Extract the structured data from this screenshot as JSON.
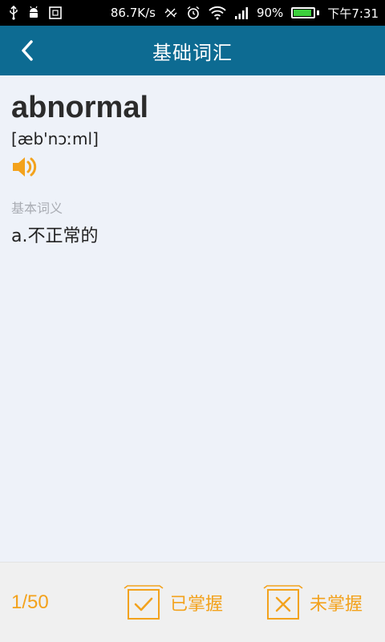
{
  "status_bar": {
    "network_speed": "86.7K/s",
    "battery_percent": "90%",
    "time": "下午7:31",
    "battery_level": 0.9,
    "icons": [
      "usb-icon",
      "android-icon",
      "screenshot-icon",
      "data-sync-icon",
      "alarm-icon",
      "wifi-icon",
      "signal-icon",
      "battery-icon"
    ]
  },
  "header": {
    "title": "基础词汇",
    "back_icon": "chevron-left-icon"
  },
  "word_card": {
    "word": "abnormal",
    "phonetic": "[æb'nɔːml]",
    "speaker_icon": "speaker-icon",
    "section_label": "基本词义",
    "definition": "a.不正常的"
  },
  "bottom_bar": {
    "progress": "1/50",
    "mastered_label": "已掌握",
    "not_mastered_label": "未掌握"
  },
  "colors": {
    "header_bg": "#0d6b92",
    "accent": "#f3a21c",
    "page_bg": "#eef2f9",
    "bottom_bg": "#f0f0f0"
  }
}
